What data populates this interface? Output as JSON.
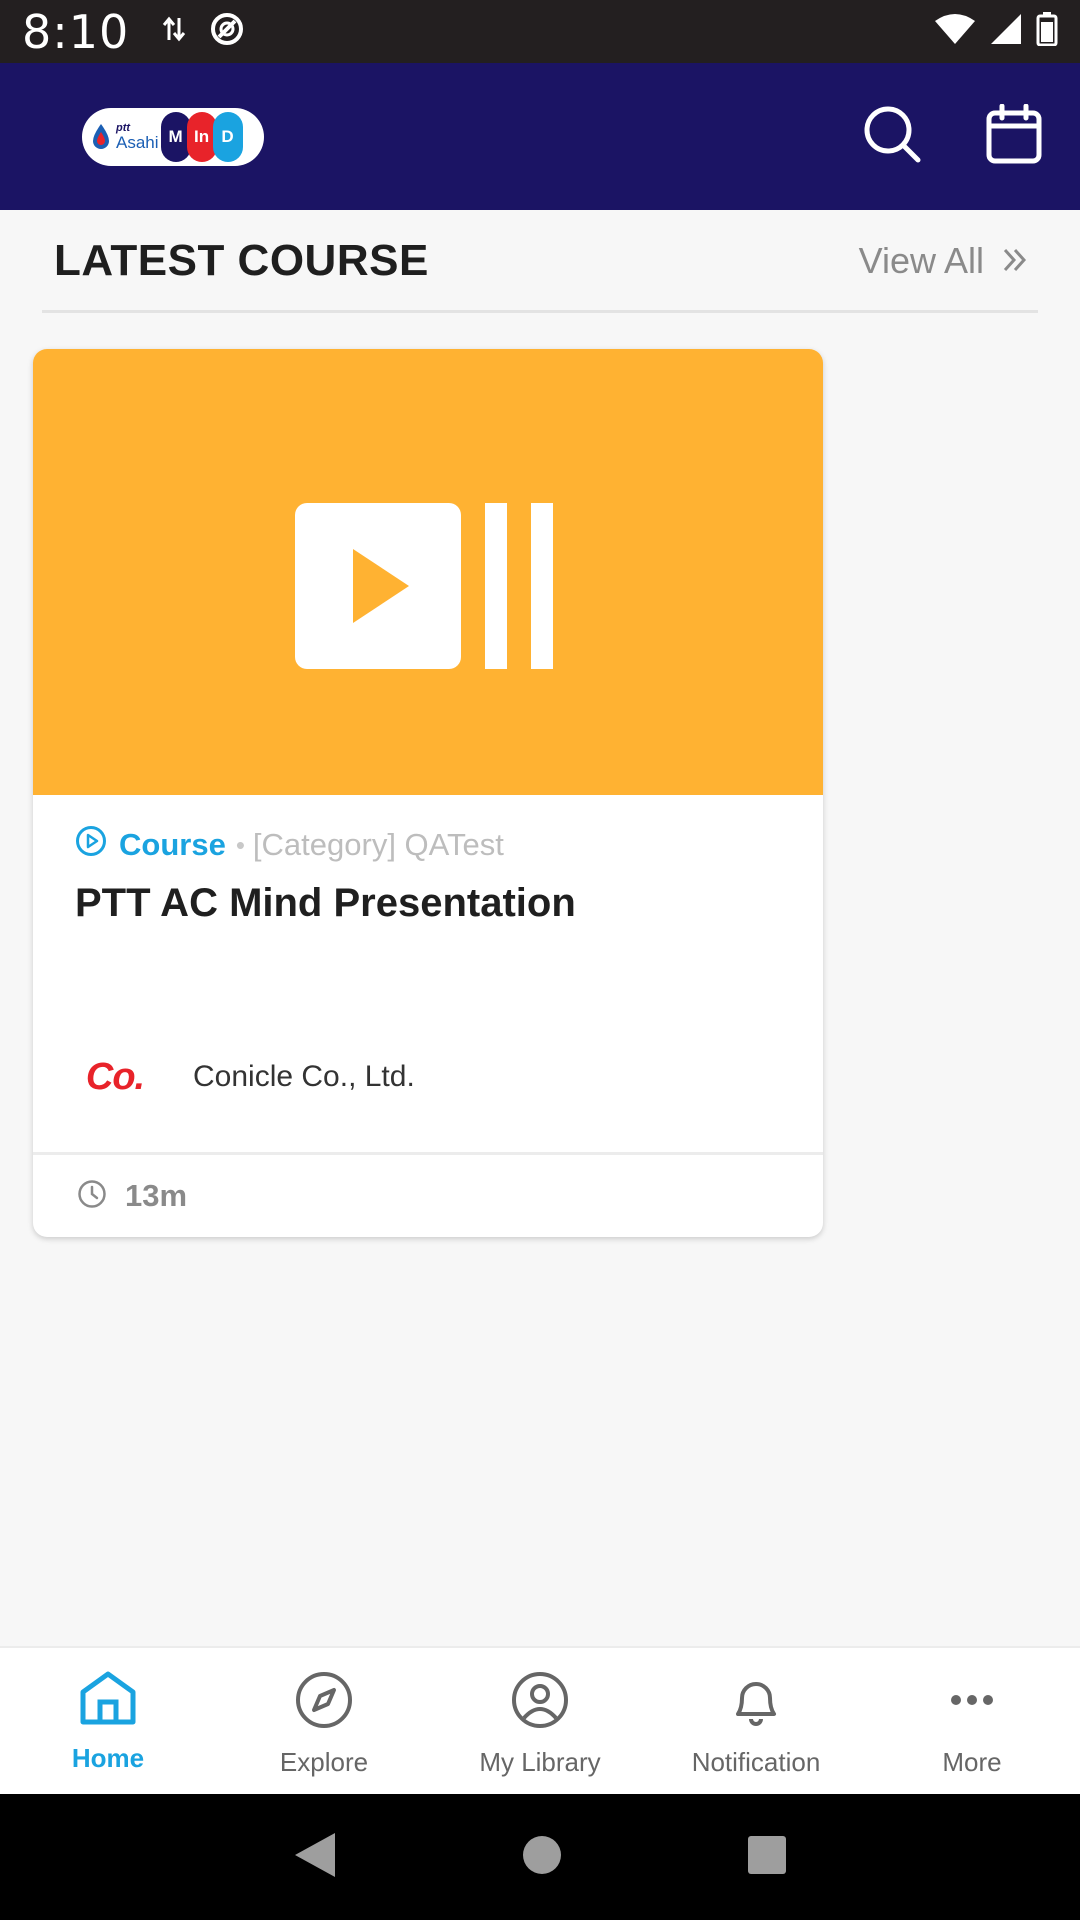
{
  "status_bar": {
    "time": "8:10"
  },
  "app": {
    "logo": {
      "ptt_text": "ptt",
      "asahi_text": "Asahi",
      "pills": [
        {
          "letter": "M",
          "color": "#1b1464"
        },
        {
          "letter": "In",
          "color": "#e8232a"
        },
        {
          "letter": "D",
          "color": "#1aa3e0"
        }
      ]
    }
  },
  "section": {
    "title": "LATEST COURSE",
    "view_all": "View All"
  },
  "course_card": {
    "type": "Course",
    "category": "[Category] QATest",
    "title": "PTT AC Mind Presentation",
    "provider_logo_text": "Co.",
    "provider_name": "Conicle Co., Ltd.",
    "duration": "13m",
    "thumbnail_color": "#ffb232"
  },
  "bottom_nav": {
    "items": [
      {
        "label": "Home",
        "icon": "home-icon",
        "active": true
      },
      {
        "label": "Explore",
        "icon": "compass-icon",
        "active": false
      },
      {
        "label": "My Library",
        "icon": "user-circle-icon",
        "active": false
      },
      {
        "label": "Notification",
        "icon": "bell-icon",
        "active": false
      },
      {
        "label": "More",
        "icon": "more-dots-icon",
        "active": false
      }
    ]
  },
  "colors": {
    "brand": "#1b1464",
    "accent": "#1aa3e0",
    "thumbnail": "#ffb232"
  }
}
